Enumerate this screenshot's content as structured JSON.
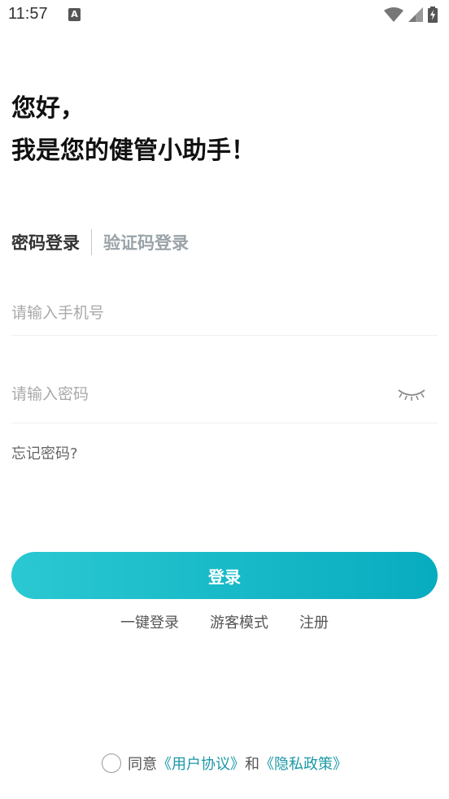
{
  "status_bar": {
    "time": "11:57",
    "notification_icon_text": "A",
    "icons": [
      "notification-icon",
      "wifi-icon",
      "signal-icon",
      "battery-charging-icon"
    ]
  },
  "greeting": {
    "line1": "您好，",
    "line2": "我是您的健管小助手！"
  },
  "tabs": {
    "password_login": "密码登录",
    "code_login": "验证码登录"
  },
  "phone_field": {
    "placeholder": "请输入手机号",
    "value": ""
  },
  "password_field": {
    "placeholder": "请输入密码",
    "value": "",
    "toggle_icon": "eye-closed-icon"
  },
  "forgot_password": "忘记密码?",
  "login_button": "登录",
  "quick_links": {
    "one_click": "一键登录",
    "guest": "游客模式",
    "register": "注册"
  },
  "agreement": {
    "prefix": "同意",
    "user_agreement": "《用户协议》",
    "and": "和",
    "privacy_policy": "《隐私政策》"
  },
  "colors": {
    "accent": "#1a98a6",
    "button_gradient_start": "#2ac8d2",
    "button_gradient_end": "#08acbf",
    "inactive_tab": "#9aa3a8"
  }
}
